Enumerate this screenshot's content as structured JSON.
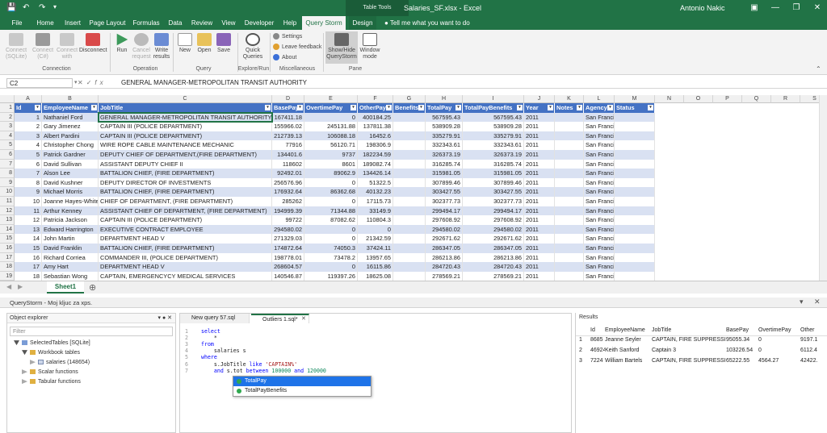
{
  "titlebar": {
    "table_tools": "Table Tools",
    "doc_title": "Salaries_SF.xlsx - Excel",
    "user": "Antonio Nakic"
  },
  "tabs": [
    "File",
    "Home",
    "Insert",
    "Page Layout",
    "Formulas",
    "Data",
    "Review",
    "View",
    "Developer",
    "Help",
    "Query Storm",
    "Design"
  ],
  "tell_me": "Tell me what you want to do",
  "ribbon": {
    "connect_sqlite": "Connect (SQLite)",
    "connect_csharp": "Connect (C#)",
    "connect_with": "Connect with",
    "disconnect": "Disconnect",
    "group_connection": "Connection",
    "run": "Run",
    "cancel": "Cancel request",
    "write": "Write results",
    "group_operation": "Operation",
    "new": "New",
    "open": "Open",
    "save": "Save",
    "group_query": "Query",
    "quick": "Quick Queries",
    "group_explore": "Explore/Run",
    "settings": "Settings",
    "feedback": "Leave feedback",
    "about": "About",
    "group_misc": "Miscellaneous",
    "showhide": "Show/Hide QueryStorm",
    "window": "Window mode",
    "group_pane": "Pane"
  },
  "formula": {
    "namebox": "C2",
    "fx": "fx",
    "content": "GENERAL MANAGER-METROPOLITAN TRANSIT AUTHORITY"
  },
  "columns": [
    "A",
    "B",
    "C",
    "D",
    "E",
    "F",
    "G",
    "H",
    "I",
    "J",
    "K",
    "L",
    "M",
    "N",
    "O",
    "P",
    "Q",
    "R",
    "S"
  ],
  "table_headers": [
    "Id",
    "EmployeeName",
    "JobTitle",
    "BasePay",
    "OvertimePay",
    "OtherPay",
    "Benefits",
    "TotalPay",
    "TotalPayBenefits",
    "Year",
    "Notes",
    "Agency",
    "Status"
  ],
  "rows": [
    [
      "1",
      "Nathaniel Ford",
      "GENERAL MANAGER-METROPOLITAN TRANSIT AUTHORITY",
      "167411.18",
      "0",
      "400184.25",
      "",
      "567595.43",
      "567595.43",
      "2011",
      "",
      "San Francisco",
      ""
    ],
    [
      "2",
      "Gary Jimenez",
      "CAPTAIN III (POLICE DEPARTMENT)",
      "155966.02",
      "245131.88",
      "137811.38",
      "",
      "538909.28",
      "538909.28",
      "2011",
      "",
      "San Francisco",
      ""
    ],
    [
      "3",
      "Albert Pardini",
      "CAPTAIN III (POLICE DEPARTMENT)",
      "212739.13",
      "106088.18",
      "16452.6",
      "",
      "335279.91",
      "335279.91",
      "2011",
      "",
      "San Francisco",
      ""
    ],
    [
      "4",
      "Christopher Chong",
      "WIRE ROPE CABLE MAINTENANCE MECHANIC",
      "77916",
      "56120.71",
      "198306.9",
      "",
      "332343.61",
      "332343.61",
      "2011",
      "",
      "San Francisco",
      ""
    ],
    [
      "5",
      "Patrick Gardner",
      "DEPUTY CHIEF OF DEPARTMENT,(FIRE DEPARTMENT)",
      "134401.6",
      "9737",
      "182234.59",
      "",
      "326373.19",
      "326373.19",
      "2011",
      "",
      "San Francisco",
      ""
    ],
    [
      "6",
      "David Sullivan",
      "ASSISTANT DEPUTY CHIEF II",
      "118602",
      "8601",
      "189082.74",
      "",
      "316285.74",
      "316285.74",
      "2011",
      "",
      "San Francisco",
      ""
    ],
    [
      "7",
      "Alson Lee",
      "BATTALION CHIEF, (FIRE DEPARTMENT)",
      "92492.01",
      "89062.9",
      "134426.14",
      "",
      "315981.05",
      "315981.05",
      "2011",
      "",
      "San Francisco",
      ""
    ],
    [
      "8",
      "David Kushner",
      "DEPUTY DIRECTOR OF INVESTMENTS",
      "256576.96",
      "0",
      "51322.5",
      "",
      "307899.46",
      "307899.46",
      "2011",
      "",
      "San Francisco",
      ""
    ],
    [
      "9",
      "Michael Morris",
      "BATTALION CHIEF, (FIRE DEPARTMENT)",
      "176932.64",
      "86362.68",
      "40132.23",
      "",
      "303427.55",
      "303427.55",
      "2011",
      "",
      "San Francisco",
      ""
    ],
    [
      "10",
      "Joanne Hayes-White",
      "CHIEF OF DEPARTMENT, (FIRE DEPARTMENT)",
      "285262",
      "0",
      "17115.73",
      "",
      "302377.73",
      "302377.73",
      "2011",
      "",
      "San Francisco",
      ""
    ],
    [
      "11",
      "Arthur Kenney",
      "ASSISTANT CHIEF OF DEPARTMENT, (FIRE DEPARTMENT)",
      "194999.39",
      "71344.88",
      "33149.9",
      "",
      "299494.17",
      "299494.17",
      "2011",
      "",
      "San Francisco",
      ""
    ],
    [
      "12",
      "Patricia Jackson",
      "CAPTAIN III (POLICE DEPARTMENT)",
      "99722",
      "87082.62",
      "110804.3",
      "",
      "297608.92",
      "297608.92",
      "2011",
      "",
      "San Francisco",
      ""
    ],
    [
      "13",
      "Edward Harrington",
      "EXECUTIVE CONTRACT EMPLOYEE",
      "294580.02",
      "0",
      "0",
      "",
      "294580.02",
      "294580.02",
      "2011",
      "",
      "San Francisco",
      ""
    ],
    [
      "14",
      "John Martin",
      "DEPARTMENT HEAD V",
      "271329.03",
      "0",
      "21342.59",
      "",
      "292671.62",
      "292671.62",
      "2011",
      "",
      "San Francisco",
      ""
    ],
    [
      "15",
      "David Franklin",
      "BATTALION CHIEF, (FIRE DEPARTMENT)",
      "174872.64",
      "74050.3",
      "37424.11",
      "",
      "286347.05",
      "286347.05",
      "2011",
      "",
      "San Francisco",
      ""
    ],
    [
      "16",
      "Richard Corriea",
      "COMMANDER III, (POLICE DEPARTMENT)",
      "198778.01",
      "73478.2",
      "13957.65",
      "",
      "286213.86",
      "286213.86",
      "2011",
      "",
      "San Francisco",
      ""
    ],
    [
      "17",
      "Amy Hart",
      "DEPARTMENT HEAD V",
      "268604.57",
      "0",
      "16115.86",
      "",
      "284720.43",
      "284720.43",
      "2011",
      "",
      "San Francisco",
      ""
    ],
    [
      "18",
      "Sebastian Wong",
      "CAPTAIN, EMERGENCYCY MEDICAL SERVICES",
      "140546.87",
      "119397.26",
      "18625.08",
      "",
      "278569.21",
      "278569.21",
      "2011",
      "",
      "San Francisco",
      ""
    ]
  ],
  "sheet_tab": "Sheet1",
  "qs_title": "QueryStorm - Moj kljuc za xps.",
  "object_explorer": {
    "title": "Object explorer",
    "filter": "Filter",
    "tree": [
      "SelectedTables [SQLite]",
      "Workbook tables",
      "salaries (148654)",
      "Scalar functions",
      "Tabular functions"
    ]
  },
  "editor": {
    "tabs": [
      "New query 57.sql",
      "Outliers 1.sql*"
    ],
    "line_numbers": [
      "1",
      "2",
      "3",
      "4",
      "5",
      "6",
      "7"
    ],
    "lines": [
      [
        {
          "t": "select",
          "c": "kw"
        }
      ],
      [
        {
          "t": "    *",
          "c": ""
        }
      ],
      [
        {
          "t": "from",
          "c": "kw"
        }
      ],
      [
        {
          "t": "    salaries s",
          "c": ""
        }
      ],
      [
        {
          "t": "where",
          "c": "kw"
        }
      ],
      [
        {
          "t": "    s.JobTitle ",
          "c": ""
        },
        {
          "t": "like",
          "c": "kw"
        },
        {
          "t": " 'CAPTAIN%'",
          "c": "str"
        }
      ],
      [
        {
          "t": "    ",
          "c": ""
        },
        {
          "t": "and",
          "c": "kw"
        },
        {
          "t": " s.tot",
          "c": ""
        },
        {
          "t": " between",
          "c": "kw"
        },
        {
          "t": " 100000",
          "c": "numc"
        },
        {
          "t": " and",
          "c": "kw"
        },
        {
          "t": " 120000",
          "c": "numc"
        }
      ]
    ],
    "autocomplete": [
      "TotalPay",
      "TotalPayBenefits"
    ]
  },
  "results": {
    "title": "Results",
    "headers": [
      "Id",
      "EmployeeName",
      "JobTitle",
      "BasePay",
      "OvertimePay",
      "Other"
    ],
    "rows": [
      [
        "1",
        "8685",
        "Jeanne Seyler",
        "CAPTAIN, FIRE SUPPRESSION",
        "95055.34",
        "0",
        "9197.1"
      ],
      [
        "2",
        "46924",
        "Keith Sanford",
        "Captain 3",
        "103226.54",
        "0",
        "6112.4"
      ],
      [
        "3",
        "7224",
        "William Bartels",
        "CAPTAIN, FIRE SUPPRESSION",
        "65222.55",
        "4564.27",
        "42422."
      ]
    ]
  },
  "colors": {
    "excel_green": "#217346",
    "table_header": "#4472c4",
    "band": "#d9e1f2"
  }
}
